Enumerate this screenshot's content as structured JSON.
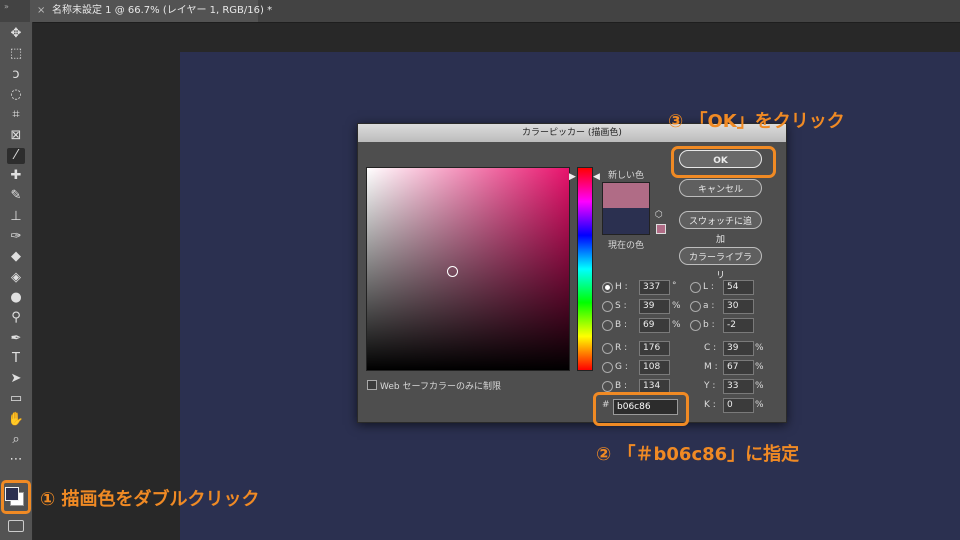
{
  "document_tab": {
    "title": "名称未設定 1 @ 66.7% (レイヤー 1, RGB/16) *",
    "close_glyph": "×",
    "panel_collapse_glyph": "»"
  },
  "toolbar": {
    "tools": [
      {
        "name": "move-tool-icon",
        "glyph": "✥"
      },
      {
        "name": "marquee-tool-icon",
        "glyph": "⬚"
      },
      {
        "name": "lasso-tool-icon",
        "glyph": "ↄ"
      },
      {
        "name": "quick-select-tool-icon",
        "glyph": "◌"
      },
      {
        "name": "crop-tool-icon",
        "glyph": "⌗"
      },
      {
        "name": "frame-tool-icon",
        "glyph": "⊠"
      },
      {
        "name": "eyedropper-tool-icon",
        "glyph": "⁄",
        "active": true
      },
      {
        "name": "healing-brush-icon",
        "glyph": "✚"
      },
      {
        "name": "brush-tool-icon",
        "glyph": "✎"
      },
      {
        "name": "stamp-tool-icon",
        "glyph": "⊥"
      },
      {
        "name": "history-brush-icon",
        "glyph": "✑"
      },
      {
        "name": "eraser-tool-icon",
        "glyph": "◆"
      },
      {
        "name": "paint-bucket-icon",
        "glyph": "◈"
      },
      {
        "name": "blur-tool-icon",
        "glyph": "●"
      },
      {
        "name": "dodge-tool-icon",
        "glyph": "⚲"
      },
      {
        "name": "pen-tool-icon",
        "glyph": "✒"
      },
      {
        "name": "type-tool-icon",
        "glyph": "T"
      },
      {
        "name": "path-select-icon",
        "glyph": "➤"
      },
      {
        "name": "rectangle-tool-icon",
        "glyph": "▭"
      },
      {
        "name": "hand-tool-icon",
        "glyph": "✋"
      },
      {
        "name": "zoom-tool-icon",
        "glyph": "⌕"
      },
      {
        "name": "more-tools-icon",
        "glyph": "⋯"
      }
    ],
    "foreground_color": "#2b3050",
    "background_color": "#ffffff"
  },
  "dialog": {
    "title": "カラーピッカー (描画色)",
    "new_label": "新しい色",
    "current_label": "現在の色",
    "new_color": "#b06c86",
    "current_color": "#2b3050",
    "buttons": {
      "ok": "OK",
      "cancel": "キャンセル",
      "swatches": "スウォッチに追加",
      "libraries": "カラーライブラリ"
    },
    "hsb": {
      "h_label": "H :",
      "h": "337",
      "h_unit": "°",
      "s_label": "S :",
      "s": "39",
      "s_unit": "%",
      "b_label": "B :",
      "b": "69",
      "b_unit": "%"
    },
    "rgb": {
      "r_label": "R :",
      "r": "176",
      "g_label": "G :",
      "g": "108",
      "b_label": "B :",
      "b": "134"
    },
    "lab": {
      "l_label": "L :",
      "l": "54",
      "a_label": "a :",
      "a": "30",
      "b_label": "b :",
      "b": "-2"
    },
    "cmyk": {
      "c_label": "C :",
      "c": "39",
      "m_label": "M :",
      "m": "67",
      "y_label": "Y :",
      "y": "33",
      "k_label": "K :",
      "k": "0",
      "unit": "%"
    },
    "hex_hash": "#",
    "hex": "b06c86",
    "websafe_label": "Web セーフカラーのみに制限"
  },
  "annotations": {
    "step1": "① 描画色をダブルクリック",
    "step2": "② 「＃b06c86」に指定",
    "step3": "③ 「OK」をクリック"
  },
  "colors": {
    "accent": "#f08a24",
    "canvas": "#2b3050"
  }
}
